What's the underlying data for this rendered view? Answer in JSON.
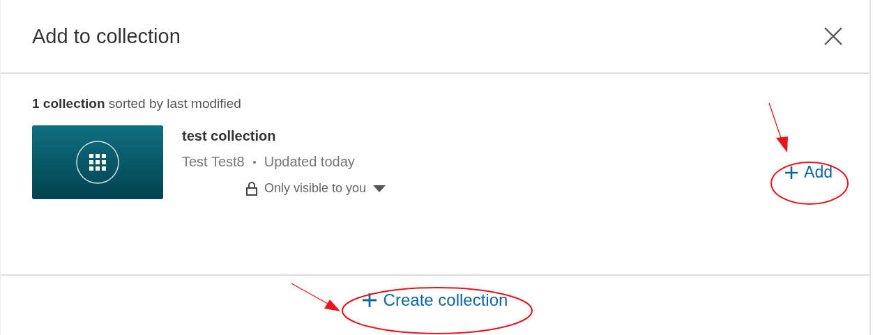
{
  "dialog": {
    "title": "Add to collection"
  },
  "summary": "**1 collection** sorted by last modified",
  "collections": [
    {
      "name": "test collection",
      "owner": "Test Test8",
      "updated": "Updated today",
      "visibility": "Only visible to you",
      "action": "Add"
    }
  ],
  "footer": {
    "create_button": "Create collection"
  }
}
